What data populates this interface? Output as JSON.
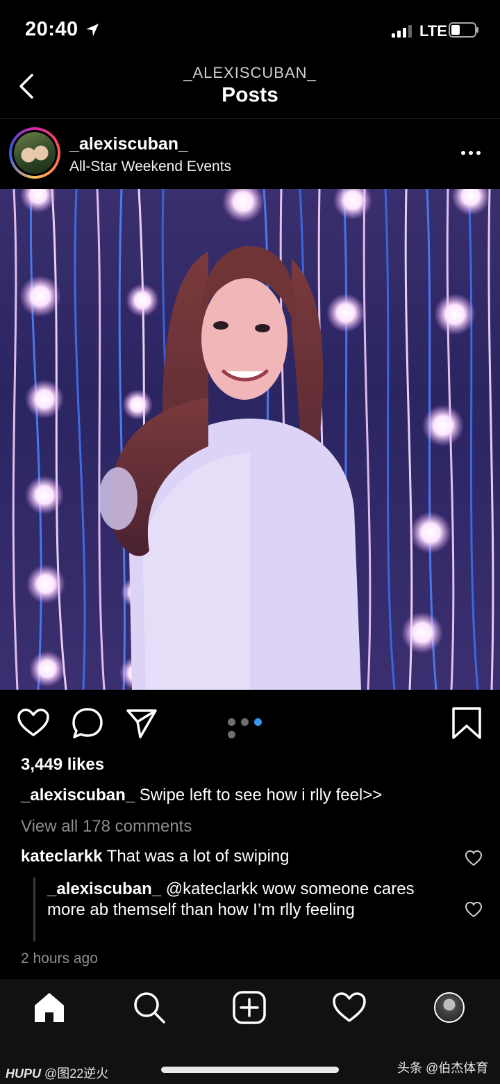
{
  "status_bar": {
    "time": "20:40",
    "network": "LTE"
  },
  "nav": {
    "subtitle": "_ALEXISCUBAN_",
    "title": "Posts"
  },
  "post": {
    "username": "_alexiscuban_",
    "location": "All-Star Weekend Events",
    "carousel": {
      "total": 4,
      "active_index": 2
    },
    "likes": "3,449 likes",
    "caption": {
      "user": "_alexiscuban_",
      "text": " Swipe left to see how i rlly feel>>"
    },
    "view_all_comments": "View all 178 comments",
    "comments": [
      {
        "user": "kateclarkk",
        "text": " That was a lot of swiping"
      }
    ],
    "reply": {
      "user": "_alexiscuban_",
      "text": " @kateclarkk wow someone cares more ab themself than how I’m rlly feeling"
    },
    "timestamp": "2 hours ago"
  },
  "tab_bar": {
    "items": [
      "home-icon",
      "search-icon",
      "add-post-icon",
      "activity-heart-icon",
      "profile-avatar"
    ]
  },
  "watermarks": {
    "left_brand": "HUPU",
    "left_text": " @图22逆火",
    "right_text": "头条 @伯杰体育"
  },
  "colors": {
    "background": "#000000",
    "active_dot": "#3897f0",
    "muted_text": "#8e8e8e"
  }
}
